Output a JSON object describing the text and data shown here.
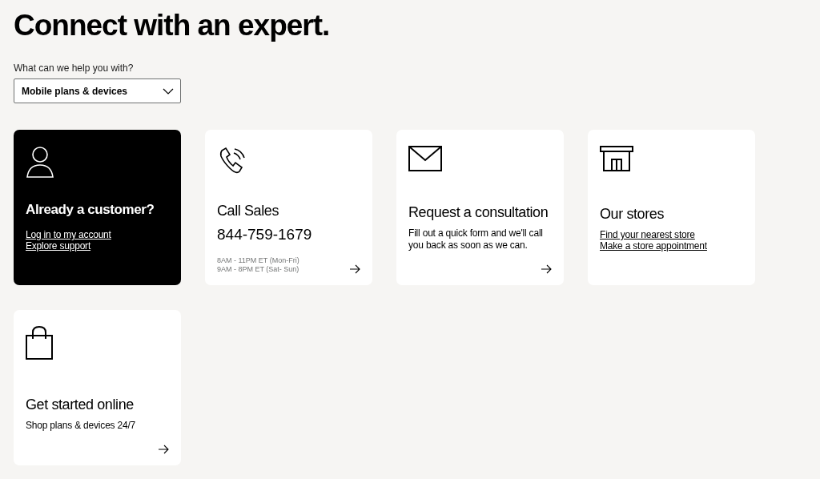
{
  "heading": "Connect with an expert.",
  "topic": {
    "label": "What can we help you with?",
    "value": "Mobile plans & devices"
  },
  "cards": [
    {
      "kind": "account",
      "dark": true,
      "title": "Already a customer?",
      "links": [
        "Log in to my account",
        "Explore support"
      ],
      "arrow": false
    },
    {
      "kind": "call",
      "dark": false,
      "title": "Call Sales",
      "phone": "844-759-1679",
      "hours": [
        "8AM - 11PM ET (Mon-Fri)",
        "9AM - 8PM ET (Sat- Sun)"
      ],
      "arrow": true
    },
    {
      "kind": "form",
      "dark": false,
      "title": "Request a consultation",
      "description": "Fill out a quick form and we'll call you back as soon as we can.",
      "arrow": true
    },
    {
      "kind": "stores",
      "dark": false,
      "title": "Our stores",
      "links": [
        "Find your nearest store",
        "Make a store appointment"
      ],
      "arrow": false
    },
    {
      "kind": "shop",
      "dark": false,
      "title": "Get started online",
      "description": "Shop plans & devices 24/7",
      "arrow": true
    }
  ]
}
